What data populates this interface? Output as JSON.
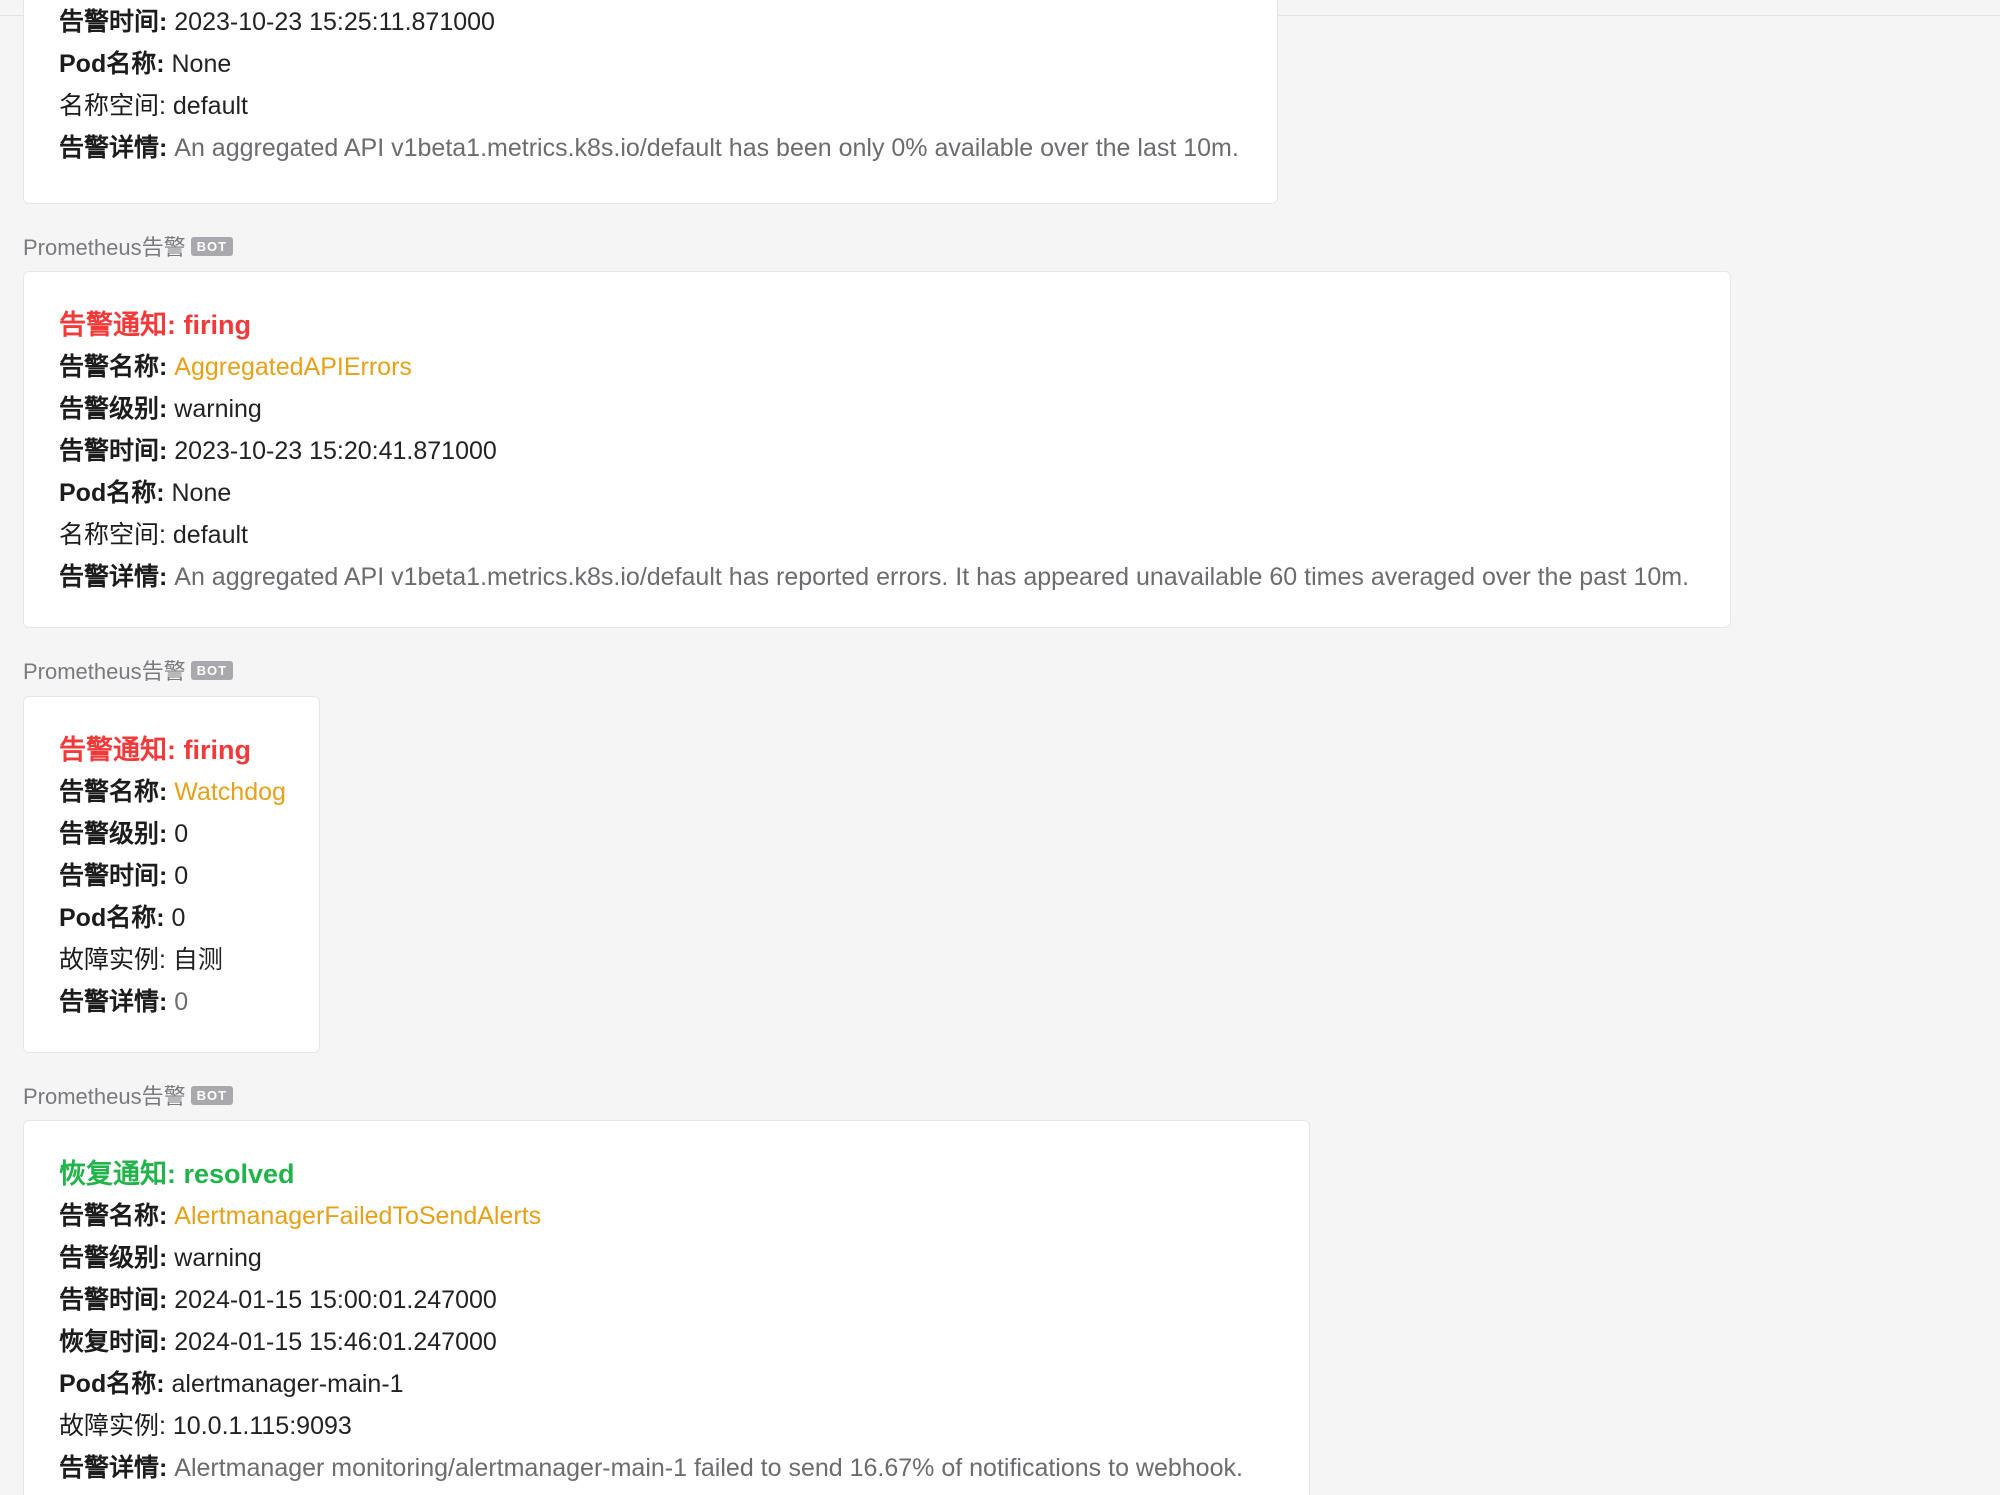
{
  "sender_name": "Prometheus告警",
  "bot_badge": "BOT",
  "labels": {
    "alert_name": "告警名称: ",
    "alert_level": "告警级别: ",
    "alert_time": "告警时间: ",
    "recover_time": "恢复时间: ",
    "pod_name": "Pod名称: ",
    "namespace": "名称空间: ",
    "instance": "故障实例: ",
    "alert_detail": "告警详情: "
  },
  "messages": [
    {
      "alert_time": "2023-10-23 15:25:11.871000",
      "pod_name": "None",
      "namespace": "default",
      "alert_detail": "An aggregated API v1beta1.metrics.k8s.io/default has been only 0% available over the last 10m."
    },
    {
      "headline": "告警通知: firing",
      "alert_name": "AggregatedAPIErrors",
      "alert_level": "warning",
      "alert_time": "2023-10-23 15:20:41.871000",
      "pod_name": "None",
      "namespace": "default",
      "alert_detail": "An aggregated API v1beta1.metrics.k8s.io/default has reported errors. It has appeared unavailable 60 times averaged over the past 10m."
    },
    {
      "headline": "告警通知: firing",
      "alert_name": "Watchdog",
      "alert_level": "0",
      "alert_time": "0",
      "pod_name": "0",
      "instance": "自测",
      "alert_detail": "0"
    },
    {
      "headline": "恢复通知: resolved",
      "alert_name": "AlertmanagerFailedToSendAlerts",
      "alert_level": "warning",
      "alert_time": "2024-01-15 15:00:01.247000",
      "recover_time": "2024-01-15 15:46:01.247000",
      "pod_name": "alertmanager-main-1",
      "instance": "10.0.1.115:9093",
      "alert_detail": "Alertmanager monitoring/alertmanager-main-1 failed to send 16.67% of notifications to webhook."
    }
  ],
  "colors": {
    "firing": "#f23a3a",
    "resolved": "#22b34a",
    "alert_name": "#e5a118",
    "detail": "#6c6c70"
  }
}
